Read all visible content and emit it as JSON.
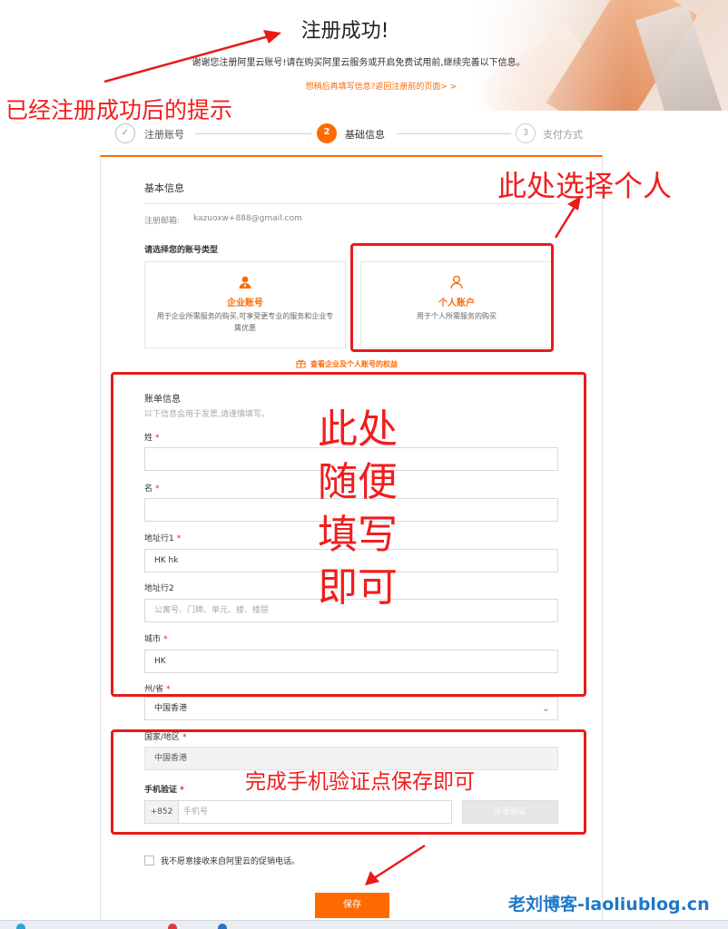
{
  "header": {
    "title": "注册成功!",
    "subtitle": "谢谢您注册阿里云账号!请在购买阿里云服务或开启免费试用前,继续完善以下信息。",
    "back_link": "想稍后再填写信息?返回注册前的页面> >"
  },
  "annotations": {
    "success_note": "已经注册成功后的提示",
    "personal_note": "此处选择个人",
    "billing_note": "此处随便填写即可",
    "phone_note": "完成手机验证点保存即可"
  },
  "steps": [
    {
      "num": "✓",
      "label": "注册账号",
      "state": "done"
    },
    {
      "num": "2",
      "label": "基础信息",
      "state": "active"
    },
    {
      "num": "3",
      "label": "支付方式",
      "state": "todo"
    }
  ],
  "form": {
    "basic_title": "基本信息",
    "email_label": "注册邮箱:",
    "email_value": "kazuoxw+888@gmail.com",
    "account_type_title": "请选择您的账号类型",
    "account_types": [
      {
        "name": "企业账号",
        "desc": "用于企业所需服务的购买,可享受更专业的服务和企业专属优惠",
        "icon": "enterprise-user-icon"
      },
      {
        "name": "个人账户",
        "desc": "用于个人所需服务的购买",
        "icon": "personal-user-icon"
      }
    ],
    "benefits_link": "查看企业及个人账号的权益",
    "billing_title": "账单信息",
    "billing_hint": "以下信息会用于发票,请谨慎填写。",
    "last_name_label": "姓",
    "first_name_label": "名",
    "address1_label": "地址行1",
    "address1_value": "HK hk",
    "address2_label": "地址行2",
    "address2_placeholder": "公寓号、门牌、单元、楼、楼层",
    "city_label": "城市",
    "city_value": "HK",
    "state_label": "州/省",
    "state_value": "中国香港",
    "country_label": "国家/地区",
    "country_value": "中国香港",
    "phone_label": "手机验证",
    "phone_prefix": "+852",
    "phone_placeholder": "手机号",
    "verify_button": "点击验证",
    "required_mark": "*",
    "opt_out_label": "我不愿意接收来自阿里云的促销电话。",
    "save_button": "保存"
  },
  "watermark": "老刘博客-laoliublog.cn",
  "colors": {
    "accent": "#ff6a00",
    "annotation": "#e81b1b",
    "watermark": "#1e78c8"
  }
}
